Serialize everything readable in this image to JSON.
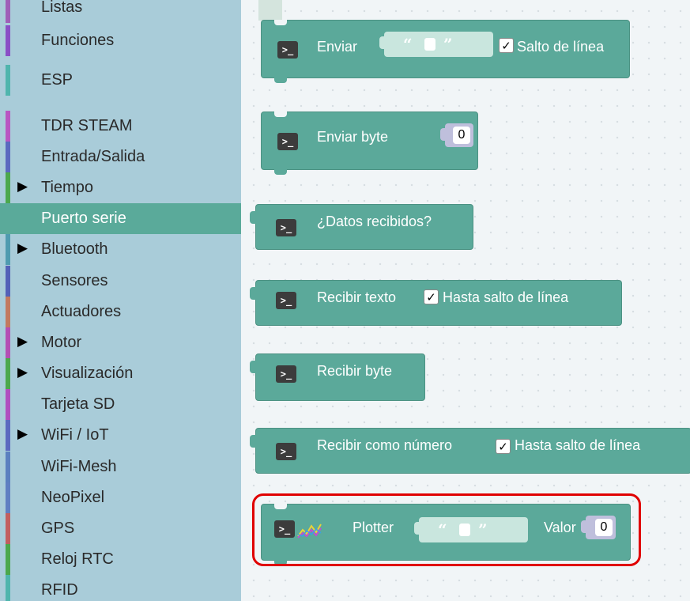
{
  "sidebar": {
    "items": [
      {
        "label": "Listas",
        "color": "#9f5fb8",
        "arrow": ""
      },
      {
        "label": "Funciones",
        "color": "#8a4fc6",
        "arrow": ""
      },
      {
        "label": "ESP",
        "color": "#4fb5ad",
        "arrow": ""
      },
      {
        "label": "TDR STEAM",
        "color": "#b956c2",
        "arrow": ""
      },
      {
        "label": "Entrada/Salida",
        "color": "#5b69c0",
        "arrow": ""
      },
      {
        "label": "Tiempo",
        "color": "#4ca84c",
        "arrow": "▶"
      },
      {
        "label": "Puerto serie",
        "color": "#5aaa9a",
        "arrow": ""
      },
      {
        "label": "Bluetooth",
        "color": "#4f9bb0",
        "arrow": "▶"
      },
      {
        "label": "Sensores",
        "color": "#5361b8",
        "arrow": ""
      },
      {
        "label": "Actuadores",
        "color": "#c27a5f",
        "arrow": ""
      },
      {
        "label": "Motor",
        "color": "#b44fb4",
        "arrow": "▶"
      },
      {
        "label": "Visualización",
        "color": "#4ca84c",
        "arrow": "▶"
      },
      {
        "label": "Tarjeta SD",
        "color": "#b04fc0",
        "arrow": ""
      },
      {
        "label": "WiFi / IoT",
        "color": "#5b69c0",
        "arrow": "▶"
      },
      {
        "label": "WiFi-Mesh",
        "color": "#5b80c0",
        "arrow": ""
      },
      {
        "label": "NeoPixel",
        "color": "#5f7fc2",
        "arrow": ""
      },
      {
        "label": "GPS",
        "color": "#c25f5f",
        "arrow": ""
      },
      {
        "label": "Reloj RTC",
        "color": "#4ca84c",
        "arrow": ""
      },
      {
        "label": "RFID",
        "color": "#4fb5ad",
        "arrow": ""
      }
    ],
    "selected": "Puerto serie"
  },
  "blocks": {
    "enviar": {
      "label": "Enviar",
      "checkbox_label": "Salto de línea",
      "checked": "✓"
    },
    "enviar_byte": {
      "label": "Enviar byte",
      "value": "0"
    },
    "datos_recibidos": {
      "label": "¿Datos recibidos?"
    },
    "recibir_texto": {
      "label": "Recibir texto",
      "checkbox_label": "Hasta salto de línea",
      "checked": "✓"
    },
    "recibir_byte": {
      "label": "Recibir byte"
    },
    "recibir_numero": {
      "label": "Recibir como número",
      "checkbox_label": "Hasta salto de línea",
      "checked": "✓"
    },
    "plotter": {
      "label": "Plotter",
      "value_label": "Valor",
      "value": "0"
    }
  },
  "icons": {
    "terminal": "terminal-icon",
    "plotter": "chart-line-icon"
  },
  "string_quotes": {
    "open": "“",
    "close": "”"
  },
  "colors": {
    "serial_block": "#5ba99a",
    "highlight": "#e00000",
    "sidebar_bg": "#a9ccd9"
  }
}
